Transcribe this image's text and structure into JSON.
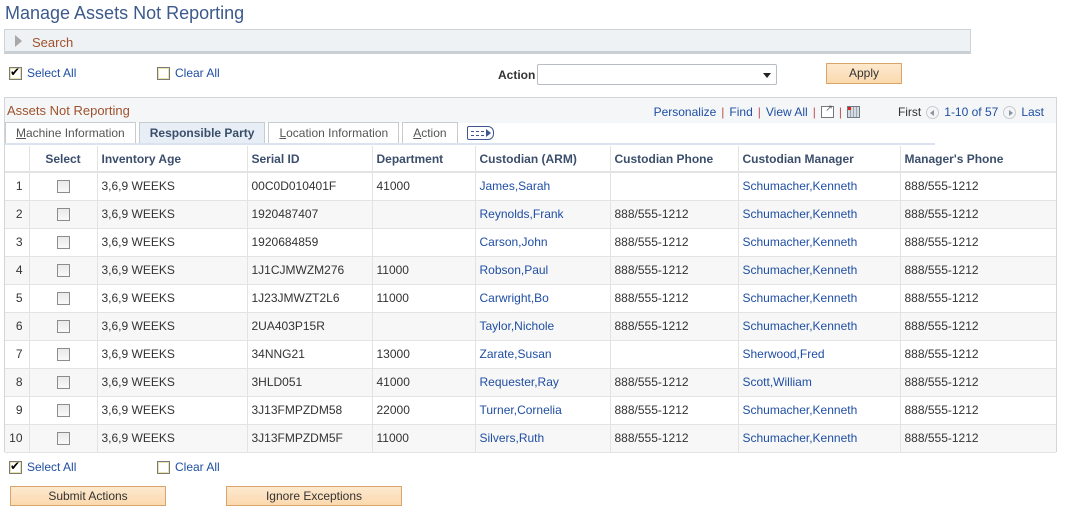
{
  "page": {
    "title": "Manage Assets Not Reporting"
  },
  "search": {
    "label": "Search"
  },
  "top_controls": {
    "select_all_label": "Select All",
    "clear_all_label": "Clear All",
    "action_label": "Action",
    "action_value": "",
    "apply_label": "Apply"
  },
  "grid": {
    "title": "Assets Not Reporting",
    "nav": {
      "personalize": "Personalize",
      "find": "Find",
      "view_all": "View All",
      "separator": "|",
      "first": "First",
      "range": "1-10 of 57",
      "last": "Last"
    },
    "tabs": [
      {
        "label_ul": "M",
        "label_rest": "achine Information",
        "active": false
      },
      {
        "label_ul": "",
        "label_rest": "Responsible Party",
        "active": true
      },
      {
        "label_ul": "L",
        "label_rest": "ocation Information",
        "active": false
      },
      {
        "label_ul": "A",
        "label_rest": "ction",
        "active": false
      }
    ],
    "columns": [
      "",
      "Select",
      "Inventory Age",
      "Serial ID",
      "Department",
      "Custodian (ARM)",
      "Custodian Phone",
      "Custodian Manager",
      "Manager's Phone"
    ],
    "rows": [
      {
        "n": "1",
        "age": "3,6,9 WEEKS",
        "serial": "00C0D010401F",
        "dept": "41000",
        "custodian": "James,Sarah",
        "cust_phone": "",
        "manager": "Schumacher,Kenneth",
        "mgr_phone": "888/555-1212"
      },
      {
        "n": "2",
        "age": "3,6,9 WEEKS",
        "serial": "1920487407",
        "dept": "",
        "custodian": "Reynolds,Frank",
        "cust_phone": "888/555-1212",
        "manager": "Schumacher,Kenneth",
        "mgr_phone": "888/555-1212"
      },
      {
        "n": "3",
        "age": "3,6,9 WEEKS",
        "serial": "1920684859",
        "dept": "",
        "custodian": "Carson,John",
        "cust_phone": "888/555-1212",
        "manager": "Schumacher,Kenneth",
        "mgr_phone": "888/555-1212"
      },
      {
        "n": "4",
        "age": "3,6,9 WEEKS",
        "serial": "1J1CJMWZM276",
        "dept": "11000",
        "custodian": "Robson,Paul",
        "cust_phone": "888/555-1212",
        "manager": "Schumacher,Kenneth",
        "mgr_phone": "888/555-1212"
      },
      {
        "n": "5",
        "age": "3,6,9 WEEKS",
        "serial": "1J23JMWZT2L6",
        "dept": "11000",
        "custodian": "Carwright,Bo",
        "cust_phone": "888/555-1212",
        "manager": "Schumacher,Kenneth",
        "mgr_phone": "888/555-1212"
      },
      {
        "n": "6",
        "age": "3,6,9 WEEKS",
        "serial": "2UA403P15R",
        "dept": "",
        "custodian": "Taylor,Nichole",
        "cust_phone": "888/555-1212",
        "manager": "Schumacher,Kenneth",
        "mgr_phone": "888/555-1212"
      },
      {
        "n": "7",
        "age": "3,6,9 WEEKS",
        "serial": "34NNG21",
        "dept": "13000",
        "custodian": "Zarate,Susan",
        "cust_phone": "",
        "manager": "Sherwood,Fred",
        "mgr_phone": "888/555-1212"
      },
      {
        "n": "8",
        "age": "3,6,9 WEEKS",
        "serial": "3HLD051",
        "dept": "41000",
        "custodian": "Requester,Ray",
        "cust_phone": "888/555-1212",
        "manager": "Scott,William",
        "mgr_phone": "888/555-1212"
      },
      {
        "n": "9",
        "age": "3,6,9 WEEKS",
        "serial": "3J13FMPZDM58",
        "dept": "22000",
        "custodian": "Turner,Cornelia",
        "cust_phone": "888/555-1212",
        "manager": "Schumacher,Kenneth",
        "mgr_phone": "888/555-1212"
      },
      {
        "n": "10",
        "age": "3,6,9 WEEKS",
        "serial": "3J13FMPZDM5F",
        "dept": "11000",
        "custodian": "Silvers,Ruth",
        "cust_phone": "888/555-1212",
        "manager": "Schumacher,Kenneth",
        "mgr_phone": "888/555-1212"
      }
    ]
  },
  "bottom_controls": {
    "select_all_label": "Select All",
    "clear_all_label": "Clear All",
    "submit_label": "Submit Actions",
    "ignore_label": "Ignore Exceptions"
  },
  "colors": {
    "title": "#3c5a8c",
    "link": "#1f4ea3",
    "section_title": "#a0522d",
    "button_bg": "#fbd9ae"
  }
}
